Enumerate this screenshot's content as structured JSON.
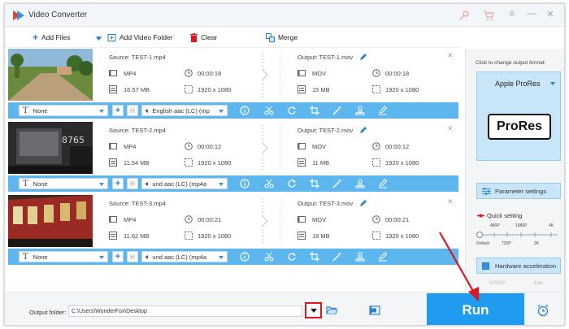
{
  "app": {
    "title": "Video Converter"
  },
  "toolbar": {
    "add_files": "Add Files",
    "add_video_folder": "Add Video Folder",
    "clear": "Clear",
    "merge": "Merge"
  },
  "files": [
    {
      "source": "Source: TEST-1.mp4",
      "src_format": "MP4",
      "src_duration": "00:00:18",
      "src_size": "16.57 MB",
      "src_resolution": "1920 x 1080",
      "output": "Output: TEST-1.mov",
      "out_format": "MOV",
      "out_duration": "00:00:18",
      "out_size": "15 MB",
      "out_resolution": "1920 x 1080",
      "subtitle": "None",
      "audio": "English aac (LC) (mp"
    },
    {
      "source": "Source: TEST-2.mp4",
      "src_format": "MP4",
      "src_duration": "00:00:12",
      "src_size": "11.54 MB",
      "src_resolution": "1920 x 1080",
      "output": "Output: TEST-2.mov",
      "out_format": "MOV",
      "out_duration": "00:00:12",
      "out_size": "11 MB",
      "out_resolution": "1920 x 1080",
      "subtitle": "None",
      "audio": "und aac (LC) (mp4a"
    },
    {
      "source": "Source: TEST-3.mp4",
      "src_format": "MP4",
      "src_duration": "00:00:21",
      "src_size": "11.62 MB",
      "src_resolution": "1920 x 1080",
      "output": "Output: TEST-3.mov",
      "out_format": "MOV",
      "out_duration": "00:00:21",
      "out_size": "18 MB",
      "out_resolution": "1920 x 1080",
      "subtitle": "None",
      "audio": "und aac (LC) (mp4a"
    }
  ],
  "right_panel": {
    "hint": "Click to change output format:",
    "format_name": "Apple ProRes",
    "format_logo": "ProRes",
    "parameter_settings": "Parameter settings",
    "quick_setting": "Quick setting",
    "ticks_top": [
      "480P",
      "1080P",
      "4K"
    ],
    "ticks_bottom": [
      "Default",
      "720P",
      "2K"
    ],
    "hardware_acceleration": "Hardware acceleration",
    "nvidia": "NVIDIA",
    "intel": "Intel"
  },
  "bottom": {
    "output_folder_label": "Output folder:",
    "output_folder_value": "C:\\Users\\WonderFox\\Desktop",
    "run": "Run"
  },
  "colors": {
    "accent": "#1f9cf0",
    "edit_bar": "#5db7ee",
    "highlight_red": "#e0151f"
  }
}
